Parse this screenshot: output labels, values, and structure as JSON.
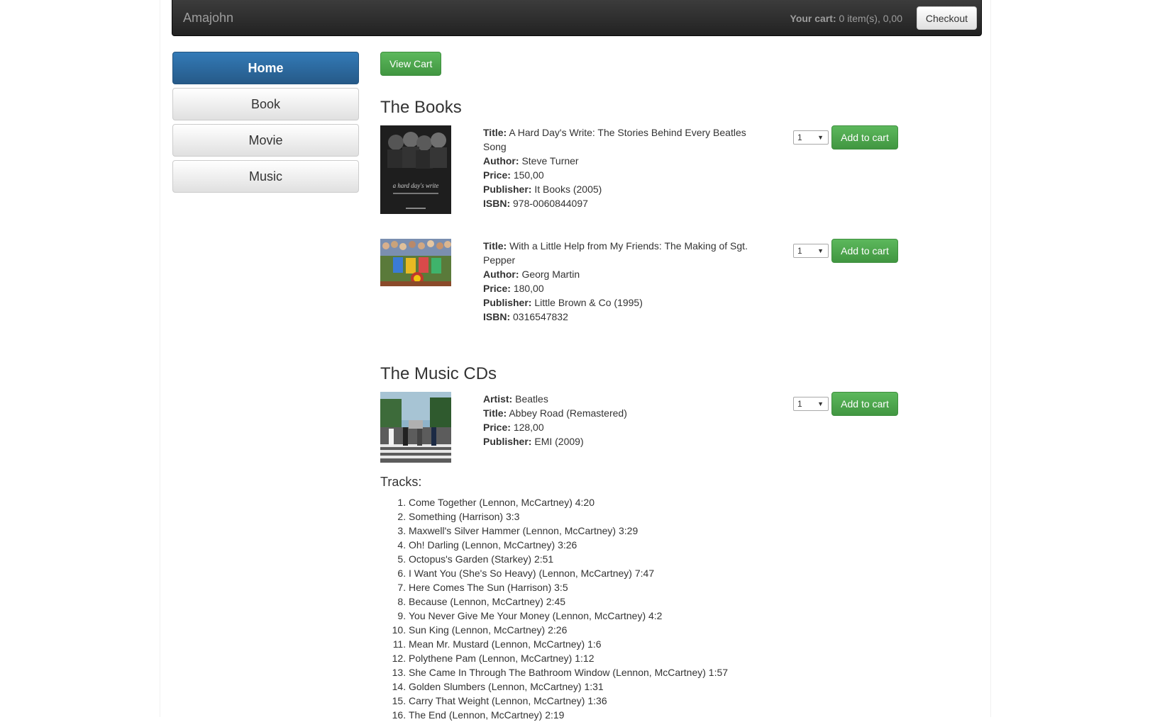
{
  "navbar": {
    "brand": "Amajohn",
    "cart_label": "Your cart:",
    "cart_value": " 0 item(s), 0,00",
    "checkout_label": "Checkout"
  },
  "sidebar": {
    "items": [
      {
        "label": "Home",
        "active": true
      },
      {
        "label": "Book",
        "active": false
      },
      {
        "label": "Movie",
        "active": false
      },
      {
        "label": "Music",
        "active": false
      }
    ]
  },
  "main": {
    "view_cart_label": "View Cart",
    "books_heading": "The Books",
    "cds_heading": "The Music CDs",
    "tracks_label": "Tracks:",
    "add_to_cart_label": "Add to cart",
    "qty_value": "1"
  },
  "labels": {
    "title": "Title:",
    "author": "Author:",
    "price": "Price:",
    "publisher": "Publisher:",
    "isbn": "ISBN:",
    "artist": "Artist:"
  },
  "books": [
    {
      "title": "A Hard Day's Write: The Stories Behind Every Beatles Song",
      "author": "Steve Turner",
      "price": "150,00",
      "publisher": "It Books (2005)",
      "isbn": "978-0060844097",
      "cover_text": "a hard day's write"
    },
    {
      "title": "With a Little Help from My Friends: The Making of Sgt. Pepper",
      "author": "Georg Martin",
      "price": "180,00",
      "publisher": "Little Brown & Co (1995)",
      "isbn": "0316547832"
    }
  ],
  "cds": [
    {
      "artist": "Beatles",
      "title": "Abbey Road (Remastered)",
      "price": "128,00",
      "publisher": "EMI (2009)"
    }
  ],
  "tracks": [
    "Come Together (Lennon, McCartney) 4:20",
    "Something (Harrison) 3:3",
    "Maxwell's Silver Hammer (Lennon, McCartney) 3:29",
    "Oh! Darling (Lennon, McCartney) 3:26",
    "Octopus's Garden (Starkey) 2:51",
    "I Want You (She's So Heavy) (Lennon, McCartney) 7:47",
    "Here Comes The Sun (Harrison) 3:5",
    "Because (Lennon, McCartney) 2:45",
    "You Never Give Me Your Money (Lennon, McCartney) 4:2",
    "Sun King (Lennon, McCartney) 2:26",
    "Mean Mr. Mustard (Lennon, McCartney) 1:6",
    "Polythene Pam (Lennon, McCartney) 1:12",
    "She Came In Through The Bathroom Window (Lennon, McCartney) 1:57",
    "Golden Slumbers (Lennon, McCartney) 1:31",
    "Carry That Weight (Lennon, McCartney) 1:36",
    "The End (Lennon, McCartney) 2:19"
  ]
}
